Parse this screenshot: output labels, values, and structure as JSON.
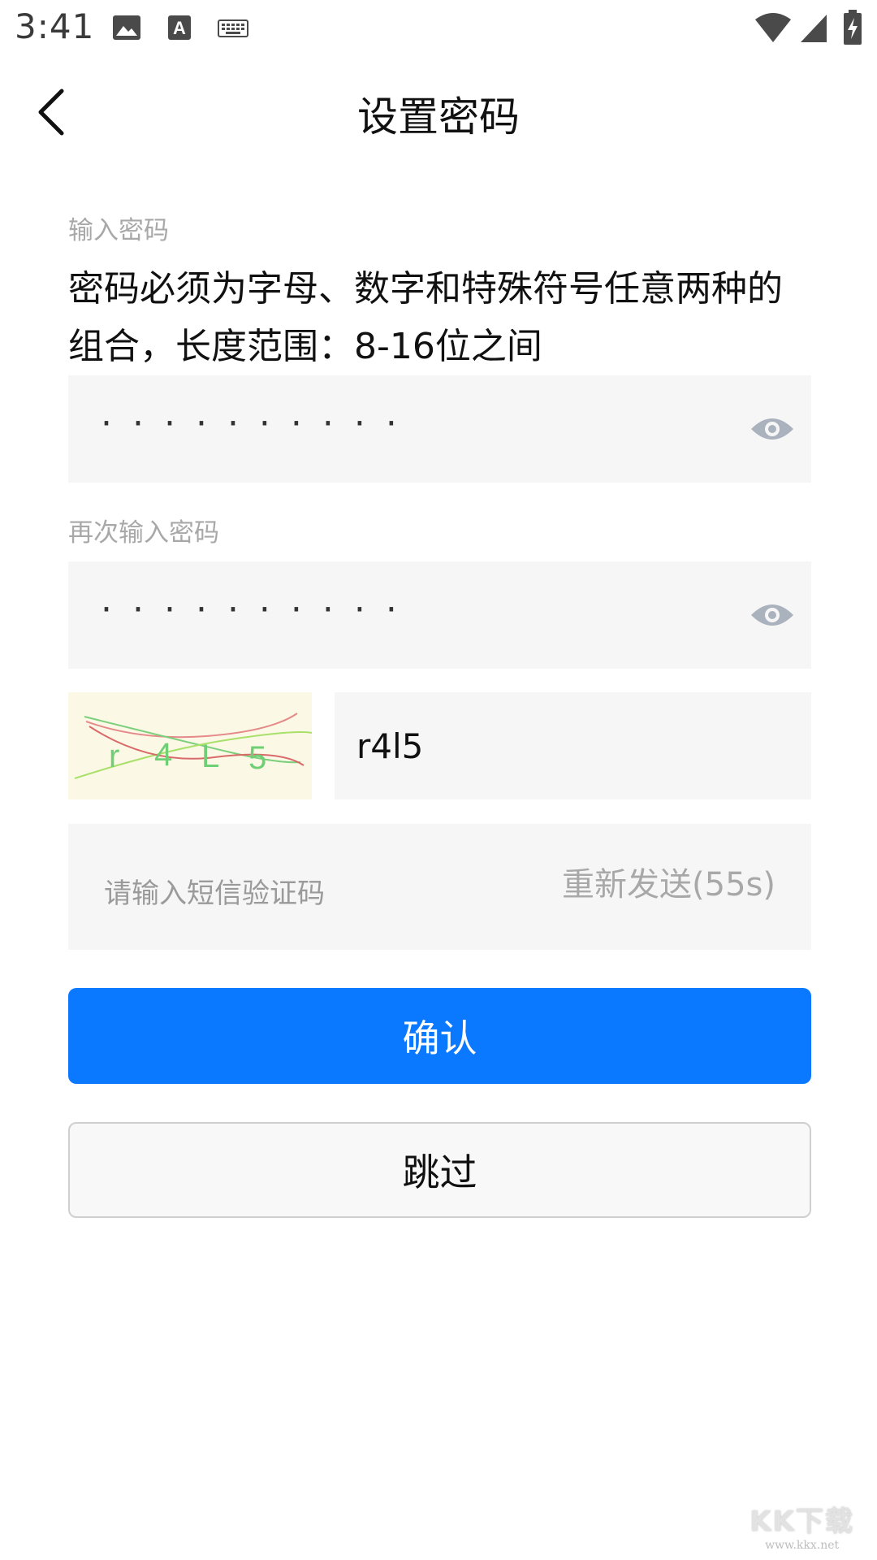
{
  "status_bar": {
    "time": "3:41",
    "icons": [
      "image-icon",
      "text-icon",
      "keyboard-icon",
      "wifi-icon",
      "signal-icon",
      "battery-icon"
    ]
  },
  "header": {
    "title": "设置密码",
    "back_icon": "chevron-left-icon"
  },
  "password": {
    "label": "输入密码",
    "rule": "密码必须为字母、数字和特殊符号任意两种的组合，长度范围：8-16位之间",
    "masked_value": "··········"
  },
  "confirm_password": {
    "label": "再次输入密码",
    "masked_value": "··········"
  },
  "captcha": {
    "image_text": [
      "r",
      "4",
      "L",
      "5"
    ],
    "input_value": "r4l5"
  },
  "sms": {
    "placeholder": "请输入短信验证码",
    "resend_label": "重新发送(55s)"
  },
  "buttons": {
    "confirm": "确认",
    "skip": "跳过"
  },
  "watermark": {
    "logo": "KK下载",
    "url": "www.kkx.net"
  },
  "colors": {
    "primary": "#0a78ff",
    "input_bg": "#f6f6f6",
    "captcha_bg": "#fcf8e6",
    "eye_icon": "#a9b2bd"
  }
}
